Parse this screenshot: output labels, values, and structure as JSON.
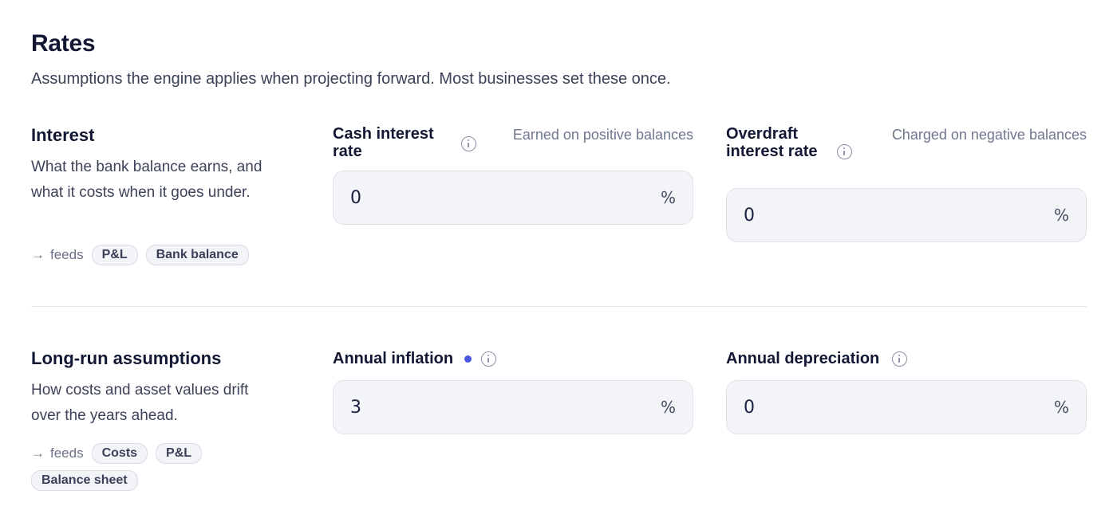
{
  "header": {
    "title": "Rates",
    "subtitle": "Assumptions the engine applies when projecting forward. Most businesses set these once."
  },
  "sections": [
    {
      "title": "Interest",
      "description": "What the bank balance earns, and what it costs when it goes under.",
      "feeds_label": "feeds",
      "feeds": [
        "P&L",
        "Bank balance"
      ],
      "fields": [
        {
          "label": "Cash interest rate",
          "hint": "Earned on positive balances",
          "value": "0",
          "unit": "%",
          "info_icon": "info-icon",
          "modified": false
        },
        {
          "label": "Overdraft interest rate",
          "hint": "Charged on negative balances",
          "value": "0",
          "unit": "%",
          "info_icon": "info-icon",
          "modified": false
        }
      ]
    },
    {
      "title": "Long-run assumptions",
      "description": "How costs and asset values drift over the years ahead.",
      "feeds_label": "feeds",
      "feeds": [
        "Costs",
        "P&L",
        "Balance sheet"
      ],
      "fields": [
        {
          "label": "Annual inflation",
          "hint": "",
          "value": "3",
          "unit": "%",
          "info_icon": "info-icon",
          "modified": true
        },
        {
          "label": "Annual depreciation",
          "hint": "",
          "value": "0",
          "unit": "%",
          "info_icon": "info-icon",
          "modified": false
        }
      ]
    }
  ],
  "colors": {
    "accent_dot": "#4a56e2",
    "input_bg": "#f3f4f8",
    "divider": "#e4e6ee"
  }
}
